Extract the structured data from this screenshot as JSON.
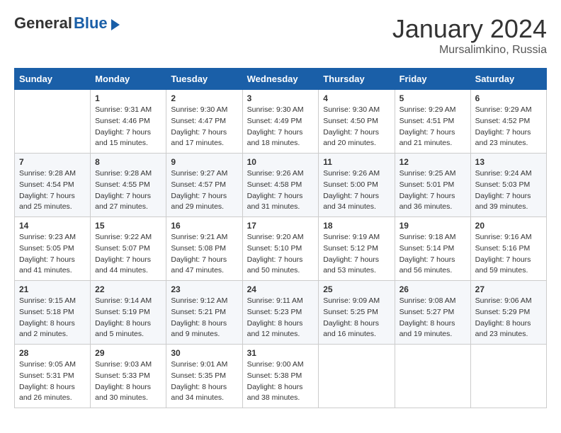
{
  "header": {
    "logo_general": "General",
    "logo_blue": "Blue",
    "month_title": "January 2024",
    "location": "Mursalimkino, Russia"
  },
  "days_of_week": [
    "Sunday",
    "Monday",
    "Tuesday",
    "Wednesday",
    "Thursday",
    "Friday",
    "Saturday"
  ],
  "weeks": [
    [
      {
        "day": "",
        "info": ""
      },
      {
        "day": "1",
        "info": "Sunrise: 9:31 AM\nSunset: 4:46 PM\nDaylight: 7 hours\nand 15 minutes."
      },
      {
        "day": "2",
        "info": "Sunrise: 9:30 AM\nSunset: 4:47 PM\nDaylight: 7 hours\nand 17 minutes."
      },
      {
        "day": "3",
        "info": "Sunrise: 9:30 AM\nSunset: 4:49 PM\nDaylight: 7 hours\nand 18 minutes."
      },
      {
        "day": "4",
        "info": "Sunrise: 9:30 AM\nSunset: 4:50 PM\nDaylight: 7 hours\nand 20 minutes."
      },
      {
        "day": "5",
        "info": "Sunrise: 9:29 AM\nSunset: 4:51 PM\nDaylight: 7 hours\nand 21 minutes."
      },
      {
        "day": "6",
        "info": "Sunrise: 9:29 AM\nSunset: 4:52 PM\nDaylight: 7 hours\nand 23 minutes."
      }
    ],
    [
      {
        "day": "7",
        "info": "Sunrise: 9:28 AM\nSunset: 4:54 PM\nDaylight: 7 hours\nand 25 minutes."
      },
      {
        "day": "8",
        "info": "Sunrise: 9:28 AM\nSunset: 4:55 PM\nDaylight: 7 hours\nand 27 minutes."
      },
      {
        "day": "9",
        "info": "Sunrise: 9:27 AM\nSunset: 4:57 PM\nDaylight: 7 hours\nand 29 minutes."
      },
      {
        "day": "10",
        "info": "Sunrise: 9:26 AM\nSunset: 4:58 PM\nDaylight: 7 hours\nand 31 minutes."
      },
      {
        "day": "11",
        "info": "Sunrise: 9:26 AM\nSunset: 5:00 PM\nDaylight: 7 hours\nand 34 minutes."
      },
      {
        "day": "12",
        "info": "Sunrise: 9:25 AM\nSunset: 5:01 PM\nDaylight: 7 hours\nand 36 minutes."
      },
      {
        "day": "13",
        "info": "Sunrise: 9:24 AM\nSunset: 5:03 PM\nDaylight: 7 hours\nand 39 minutes."
      }
    ],
    [
      {
        "day": "14",
        "info": "Sunrise: 9:23 AM\nSunset: 5:05 PM\nDaylight: 7 hours\nand 41 minutes."
      },
      {
        "day": "15",
        "info": "Sunrise: 9:22 AM\nSunset: 5:07 PM\nDaylight: 7 hours\nand 44 minutes."
      },
      {
        "day": "16",
        "info": "Sunrise: 9:21 AM\nSunset: 5:08 PM\nDaylight: 7 hours\nand 47 minutes."
      },
      {
        "day": "17",
        "info": "Sunrise: 9:20 AM\nSunset: 5:10 PM\nDaylight: 7 hours\nand 50 minutes."
      },
      {
        "day": "18",
        "info": "Sunrise: 9:19 AM\nSunset: 5:12 PM\nDaylight: 7 hours\nand 53 minutes."
      },
      {
        "day": "19",
        "info": "Sunrise: 9:18 AM\nSunset: 5:14 PM\nDaylight: 7 hours\nand 56 minutes."
      },
      {
        "day": "20",
        "info": "Sunrise: 9:16 AM\nSunset: 5:16 PM\nDaylight: 7 hours\nand 59 minutes."
      }
    ],
    [
      {
        "day": "21",
        "info": "Sunrise: 9:15 AM\nSunset: 5:18 PM\nDaylight: 8 hours\nand 2 minutes."
      },
      {
        "day": "22",
        "info": "Sunrise: 9:14 AM\nSunset: 5:19 PM\nDaylight: 8 hours\nand 5 minutes."
      },
      {
        "day": "23",
        "info": "Sunrise: 9:12 AM\nSunset: 5:21 PM\nDaylight: 8 hours\nand 9 minutes."
      },
      {
        "day": "24",
        "info": "Sunrise: 9:11 AM\nSunset: 5:23 PM\nDaylight: 8 hours\nand 12 minutes."
      },
      {
        "day": "25",
        "info": "Sunrise: 9:09 AM\nSunset: 5:25 PM\nDaylight: 8 hours\nand 16 minutes."
      },
      {
        "day": "26",
        "info": "Sunrise: 9:08 AM\nSunset: 5:27 PM\nDaylight: 8 hours\nand 19 minutes."
      },
      {
        "day": "27",
        "info": "Sunrise: 9:06 AM\nSunset: 5:29 PM\nDaylight: 8 hours\nand 23 minutes."
      }
    ],
    [
      {
        "day": "28",
        "info": "Sunrise: 9:05 AM\nSunset: 5:31 PM\nDaylight: 8 hours\nand 26 minutes."
      },
      {
        "day": "29",
        "info": "Sunrise: 9:03 AM\nSunset: 5:33 PM\nDaylight: 8 hours\nand 30 minutes."
      },
      {
        "day": "30",
        "info": "Sunrise: 9:01 AM\nSunset: 5:35 PM\nDaylight: 8 hours\nand 34 minutes."
      },
      {
        "day": "31",
        "info": "Sunrise: 9:00 AM\nSunset: 5:38 PM\nDaylight: 8 hours\nand 38 minutes."
      },
      {
        "day": "",
        "info": ""
      },
      {
        "day": "",
        "info": ""
      },
      {
        "day": "",
        "info": ""
      }
    ]
  ]
}
